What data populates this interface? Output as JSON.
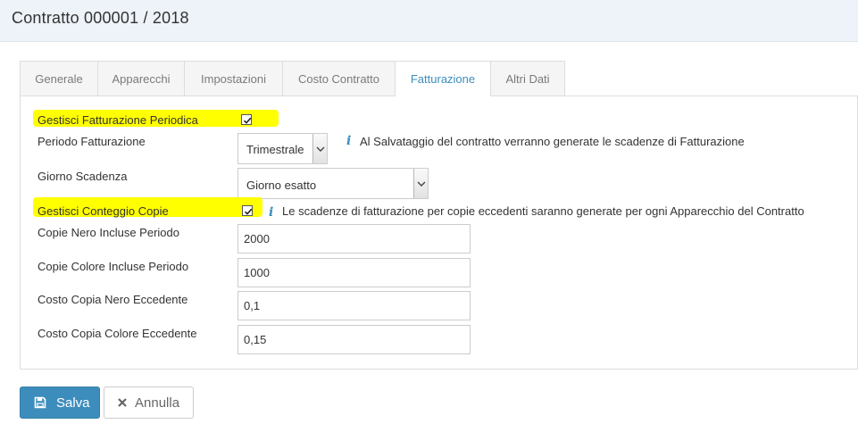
{
  "header": {
    "title": "Contratto 000001 / 2018"
  },
  "tabs": [
    {
      "label": "Generale",
      "active": false
    },
    {
      "label": "Apparecchi",
      "active": false
    },
    {
      "label": "Impostazioni",
      "active": false
    },
    {
      "label": "Costo Contratto",
      "active": false
    },
    {
      "label": "Fatturazione",
      "active": true
    },
    {
      "label": "Altri Dati",
      "active": false
    }
  ],
  "form": {
    "gestisci_fatturazione": {
      "label": "Gestisci Fatturazione Periodica",
      "checked": true
    },
    "periodo": {
      "label": "Periodo Fatturazione",
      "value": "Trimestrale",
      "info": "Al Salvataggio del contratto verranno generate le scadenze di Fatturazione"
    },
    "giorno_scadenza": {
      "label": "Giorno Scadenza",
      "value": "Giorno esatto"
    },
    "gestisci_conteggio": {
      "label": "Gestisci Conteggio Copie",
      "checked": true,
      "info": "Le scadenze di fatturazione per copie eccedenti saranno generate per ogni Apparecchio del Contratto"
    },
    "copie_nero": {
      "label": "Copie Nero Incluse Periodo",
      "value": "2000"
    },
    "copie_colore": {
      "label": "Copie Colore Incluse Periodo",
      "value": "1000"
    },
    "costo_nero": {
      "label": "Costo Copia Nero Eccedente",
      "value": "0,1"
    },
    "costo_colore": {
      "label": "Costo Copia Colore Eccedente",
      "value": "0,15"
    }
  },
  "buttons": {
    "save": "Salva",
    "cancel": "Annulla"
  },
  "icons": {
    "info": "info-icon",
    "save": "floppy-disk-icon",
    "cancel": "close-icon",
    "check": "checkmark-icon",
    "dropdown": "chevron-down-icon"
  },
  "colors": {
    "accent": "#3c8dbc",
    "highlight": "#ffff00",
    "header_bg": "#eef3f9"
  }
}
